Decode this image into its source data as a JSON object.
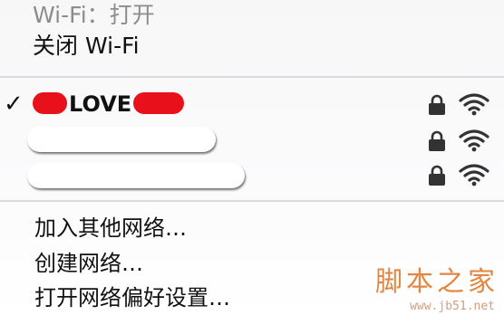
{
  "wifi_menu": {
    "status_label": "Wi-Fi：打开",
    "toggle_label": "关闭 Wi-Fi",
    "networks": [
      {
        "name_visible": "LOVE",
        "connected": true,
        "secured": true,
        "signal": "full"
      },
      {
        "name_visible": "",
        "connected": false,
        "secured": true,
        "signal": "full"
      },
      {
        "name_visible": "",
        "connected": false,
        "secured": true,
        "signal": "full"
      }
    ],
    "check_glyph": "✓",
    "actions": {
      "join_other": "加入其他网络…",
      "create": "创建网络…",
      "open_prefs": "打开网络偏好设置…"
    },
    "icons": [
      "checkmark-icon",
      "lock-icon",
      "wifi-signal-icon"
    ]
  },
  "watermark": {
    "text": "脚本之家",
    "url": "www.jb51.net"
  },
  "colors": {
    "redaction_red": "#e8101a",
    "status_gray": "#8c8c8c",
    "icon_dark": "#333333",
    "separator": "#dadada",
    "watermark_orange": "#e07a2c"
  }
}
